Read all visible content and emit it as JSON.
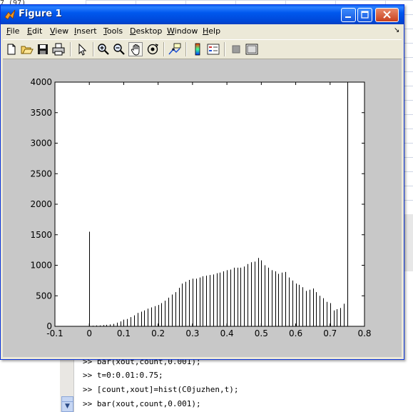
{
  "background": {
    "top_text": "7 (97)",
    "cmd_lines": [
      ">> bar(xout,count,0.001);",
      ">> t=0:0.01:0.75;",
      ">> [count,xout]=hist(C0juzhen,t);",
      ">> bar(xout,count,0.001);"
    ],
    "scroll_down_arrow": "▼"
  },
  "window": {
    "title": "Figure 1",
    "buttons": {
      "minimize": "_",
      "maximize": "□",
      "close": "×"
    }
  },
  "menu": {
    "items": [
      {
        "first": "F",
        "rest": "ile"
      },
      {
        "first": "E",
        "rest": "dit"
      },
      {
        "first": "V",
        "rest": "iew"
      },
      {
        "first": "I",
        "rest": "nsert"
      },
      {
        "first": "T",
        "rest": "ools"
      },
      {
        "first": "D",
        "rest": "esktop"
      },
      {
        "first": "W",
        "rest": "indow"
      },
      {
        "first": "H",
        "rest": "elp"
      }
    ],
    "dock_arrow": "↘"
  },
  "toolbar": {
    "icons": [
      "new-figure-icon",
      "open-file-icon",
      "save-icon",
      "print-icon",
      "edit-plot-arrow-icon",
      "zoom-in-icon",
      "zoom-out-icon",
      "pan-hand-icon",
      "rotate-3d-icon",
      "data-cursor-icon",
      "colorbar-icon",
      "legend-icon",
      "hide-plot-tools-icon",
      "show-plot-tools-icon"
    ]
  },
  "chart_data": {
    "type": "bar",
    "title": "",
    "xlabel": "",
    "ylabel": "",
    "xlim": [
      -0.1,
      0.8
    ],
    "ylim": [
      0,
      4000
    ],
    "xticks": [
      "-0.1",
      "0",
      "0.1",
      "0.2",
      "0.3",
      "0.4",
      "0.5",
      "0.6",
      "0.7",
      "0.8"
    ],
    "yticks": [
      "0",
      "500",
      "1000",
      "1500",
      "2000",
      "2500",
      "3000",
      "3500",
      "4000"
    ],
    "grid": false,
    "bar_color": "#000000",
    "x": [
      0.0,
      0.01,
      0.02,
      0.03,
      0.04,
      0.05,
      0.06,
      0.07,
      0.08,
      0.09,
      0.1,
      0.11,
      0.12,
      0.13,
      0.14,
      0.15,
      0.16,
      0.17,
      0.18,
      0.19,
      0.2,
      0.21,
      0.22,
      0.23,
      0.24,
      0.25,
      0.26,
      0.27,
      0.28,
      0.29,
      0.3,
      0.31,
      0.32,
      0.33,
      0.34,
      0.35,
      0.36,
      0.37,
      0.38,
      0.39,
      0.4,
      0.41,
      0.42,
      0.43,
      0.44,
      0.45,
      0.46,
      0.47,
      0.48,
      0.49,
      0.5,
      0.51,
      0.52,
      0.53,
      0.54,
      0.55,
      0.56,
      0.57,
      0.58,
      0.59,
      0.6,
      0.61,
      0.62,
      0.63,
      0.64,
      0.65,
      0.66,
      0.67,
      0.68,
      0.69,
      0.7,
      0.71,
      0.72,
      0.73,
      0.74,
      0.75
    ],
    "values": [
      1550,
      10,
      15,
      15,
      20,
      25,
      30,
      40,
      60,
      80,
      110,
      120,
      150,
      180,
      220,
      240,
      260,
      290,
      310,
      330,
      350,
      380,
      420,
      470,
      520,
      560,
      630,
      700,
      730,
      760,
      780,
      780,
      800,
      820,
      830,
      840,
      850,
      870,
      880,
      900,
      920,
      930,
      960,
      960,
      960,
      980,
      1020,
      1050,
      1060,
      1120,
      1080,
      1000,
      960,
      920,
      900,
      860,
      880,
      890,
      800,
      750,
      700,
      680,
      640,
      580,
      600,
      620,
      560,
      500,
      460,
      400,
      380,
      260,
      280,
      300,
      370,
      4000
    ]
  }
}
